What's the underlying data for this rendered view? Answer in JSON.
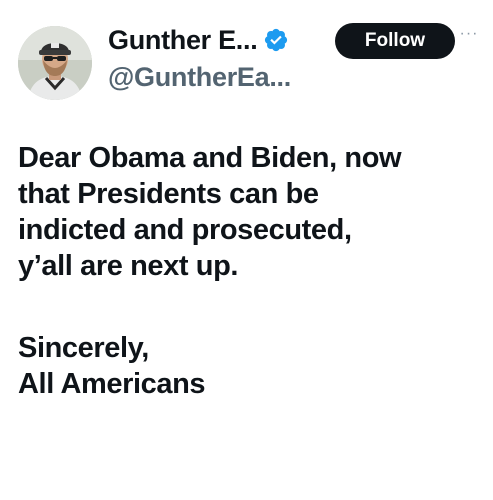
{
  "author": {
    "display_name": "Gunther E...",
    "handle": "@GuntherEa...",
    "verified": true,
    "avatar_icon": "profile-photo"
  },
  "actions": {
    "follow_label": "Follow",
    "more_icon": "more-options-icon",
    "more_glyph": "···"
  },
  "tweet": {
    "lines": [
      "Dear Obama and Biden,  now",
      "that Presidents can be",
      "indicted and prosecuted,",
      "y’all are next up."
    ],
    "signoff_lines": [
      "Sincerely,",
      "All Americans"
    ]
  },
  "colors": {
    "verified_badge": "#1d9bf0",
    "follow_button_bg": "#0f1419",
    "handle_text": "#536471"
  }
}
